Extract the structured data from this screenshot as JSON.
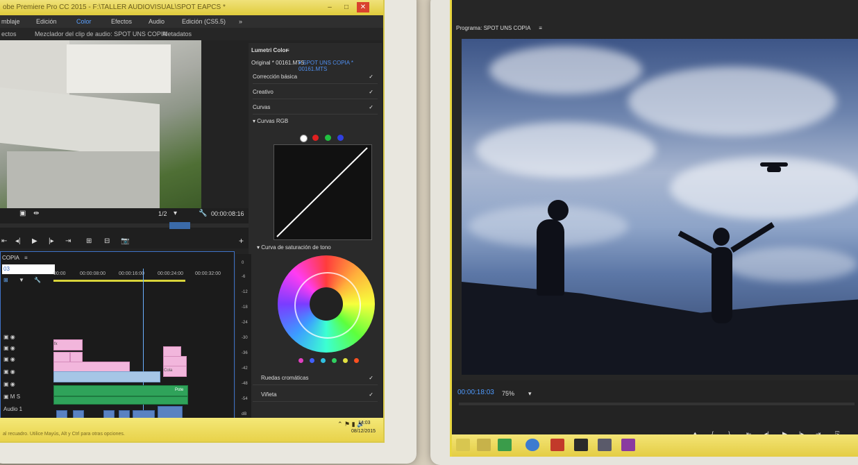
{
  "left_app": {
    "title": "obe Premiere Pro CC 2015 - F:\\TALLER AUDIOVISUAL\\SPOT EAPCS *",
    "window_buttons": [
      "–",
      "□",
      "✕"
    ],
    "menu": [
      "mblaje",
      "Edición",
      "Color",
      "Efectos",
      "Audio",
      "Edición (CS5.5)"
    ],
    "menu_active": "Color",
    "tabs": [
      "ectos",
      "Mezclador del clip de audio: SPOT UNS COPIA",
      "Metadatos"
    ],
    "overflow": "»",
    "source": {
      "zoom": "1/2",
      "timecode": "00:00:08:16",
      "add": "+"
    },
    "timeline": {
      "title": "COPIA",
      "menu": "≡",
      "search_value": "03",
      "ruler": [
        "00:00",
        "00:00:08:00",
        "00:00:16:00",
        "00:00:24:00",
        "00:00:32:00"
      ],
      "audio_label": "Audio 1",
      "tracks": [
        "M",
        "S"
      ],
      "clip_labels": [
        "fx",
        "Pote",
        "Cola"
      ]
    },
    "meter_scale": [
      "0",
      "-6",
      "-12",
      "-18",
      "-24",
      "-30",
      "-36",
      "-42",
      "-48",
      "-54",
      "dB"
    ],
    "status_hint": "al recuadro. Utilice Mayús, Alt y Ctrl para otras opciones.",
    "clock": "14:03",
    "date": "08/12/2015"
  },
  "lumetri": {
    "panel_title": "Lumetri Color",
    "menu": "≡",
    "source_label": "Original * 00161.MTS",
    "active_label": "SPOT UNS COPIA * 00161.MTS",
    "sections": [
      "Corrección básica",
      "Creativo",
      "Curvas"
    ],
    "curves_rgb": "Curvas RGB",
    "hue_sat": "Curva de saturación de tono",
    "wheels": "Ruedas cromáticas",
    "vignette": "Viñeta",
    "check": "✓",
    "channel_colors": [
      "#ffffff",
      "#e02020",
      "#20c040",
      "#3040e0"
    ],
    "sat_colors": [
      "#e040c0",
      "#4060ff",
      "#30c0e0",
      "#30d060",
      "#e0e040",
      "#ff5020"
    ]
  },
  "program": {
    "title": "Programa: SPOT UNS COPIA",
    "menu": "≡",
    "timecode": "00:00:18:03",
    "zoom": "75%",
    "controls": [
      "♦",
      "{",
      "}",
      "⇤",
      "◂|",
      "▶",
      "|▸",
      "⇥",
      "⎘"
    ]
  }
}
